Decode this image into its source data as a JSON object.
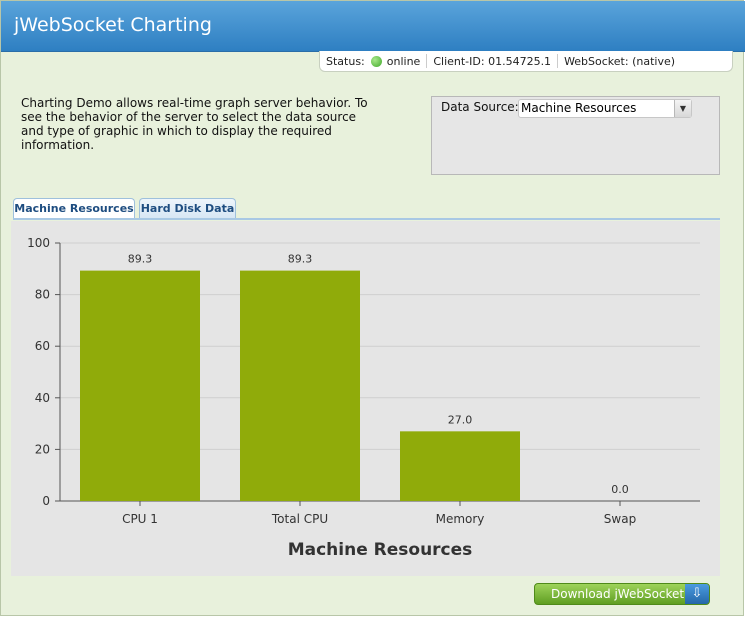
{
  "app": {
    "title": "jWebSocket Charting"
  },
  "status": {
    "status_label": "Status:",
    "status_value": "online",
    "client_id_label": "Client-ID:",
    "client_id_value": "01.54725.1",
    "websocket_label": "WebSocket:",
    "websocket_value": "(native)",
    "online_color": "#3fa82a"
  },
  "intro": {
    "text": "Charting Demo allows real-time graph server behavior. To see the behavior of the server to select the data source and type of graphic in which to display the required information."
  },
  "data_source": {
    "label": "Data Source:",
    "selected": "Machine Resources"
  },
  "tabs": [
    {
      "label": "Machine Resources",
      "active": true
    },
    {
      "label": "Hard Disk Data",
      "active": false
    }
  ],
  "download": {
    "label": "Download jWebSocket",
    "icon": "download-arrow-icon"
  },
  "chart_data": {
    "type": "bar",
    "title": "Machine Resources",
    "categories": [
      "CPU 1",
      "Total CPU",
      "Memory",
      "Swap"
    ],
    "values": [
      89.3,
      89.3,
      27.0,
      0.0
    ],
    "value_labels": [
      "89.3",
      "89.3",
      "27.0",
      "0.0"
    ],
    "ylim": [
      0,
      100
    ],
    "yticks": [
      "0",
      "20",
      "40",
      "60",
      "80",
      "100"
    ],
    "bar_color": "#90ab0a",
    "grid": true,
    "legend": "none"
  }
}
